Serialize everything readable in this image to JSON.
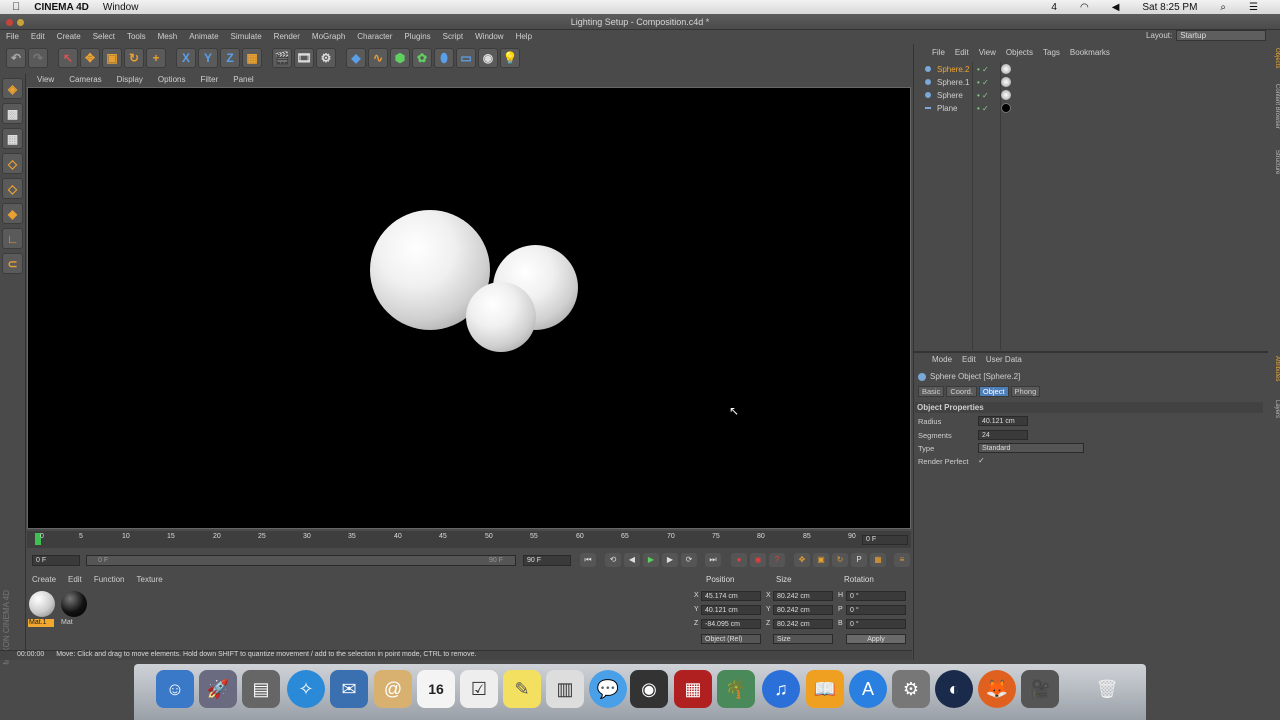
{
  "mac_menubar": {
    "app": "CINEMA 4D",
    "menu": "Window",
    "status_number": "4",
    "clock": "Sat 8:25 PM"
  },
  "window": {
    "title": "Lighting Setup - Composition.c4d *"
  },
  "c4d_menu": [
    "File",
    "Edit",
    "Create",
    "Select",
    "Tools",
    "Mesh",
    "Animate",
    "Simulate",
    "Render",
    "MoGraph",
    "Character",
    "Plugins",
    "Script",
    "Window",
    "Help"
  ],
  "layout": {
    "label": "Layout:",
    "value": "Startup"
  },
  "viewport_menu": [
    "View",
    "Cameras",
    "Display",
    "Options",
    "Filter",
    "Panel"
  ],
  "timeline": {
    "ticks": [
      "0",
      "5",
      "10",
      "15",
      "20",
      "25",
      "30",
      "35",
      "40",
      "45",
      "50",
      "55",
      "60",
      "65",
      "70",
      "75",
      "80",
      "85",
      "90"
    ],
    "frame_field": "0 F",
    "start_field": "0 F",
    "range_left": "0 F",
    "range_right": "90 F",
    "end_field": "90 F"
  },
  "material_manager": {
    "menu": [
      "Create",
      "Edit",
      "Function",
      "Texture"
    ],
    "materials": [
      {
        "name": "Mat.1",
        "selected": true
      },
      {
        "name": "Mat",
        "selected": false
      }
    ],
    "brand": "MAXON CINEMA 4D"
  },
  "coordinates": {
    "headers": [
      "Position",
      "Size",
      "Rotation"
    ],
    "rows": [
      {
        "axis": "X",
        "pos": "45.174 cm",
        "size_axis": "X",
        "size": "80.242 cm",
        "rot_axis": "H",
        "rot": "0 °"
      },
      {
        "axis": "Y",
        "pos": "40.121 cm",
        "size_axis": "Y",
        "size": "80.242 cm",
        "rot_axis": "P",
        "rot": "0 °"
      },
      {
        "axis": "Z",
        "pos": "-84.095 cm",
        "size_axis": "Z",
        "size": "80.242 cm",
        "rot_axis": "B",
        "rot": "0 °"
      }
    ],
    "mode_select": "Object (Rel)",
    "size_select": "Size",
    "apply": "Apply"
  },
  "status_bar": {
    "time": "00:00:00",
    "message": "Move: Click and drag to move elements. Hold down SHIFT to quantize movement / add to the selection in point mode, CTRL to remove."
  },
  "object_manager": {
    "menu": [
      "File",
      "Edit",
      "View",
      "Objects",
      "Tags",
      "Bookmarks"
    ],
    "objects": [
      {
        "name": "Sphere.2",
        "selected": true
      },
      {
        "name": "Sphere.1",
        "selected": false
      },
      {
        "name": "Sphere",
        "selected": false
      },
      {
        "name": "Plane",
        "selected": false
      }
    ]
  },
  "attribute_manager": {
    "menu": [
      "Mode",
      "Edit",
      "User Data"
    ],
    "title": "Sphere Object [Sphere.2]",
    "tabs": [
      {
        "label": "Basic",
        "active": false
      },
      {
        "label": "Coord.",
        "active": false
      },
      {
        "label": "Object",
        "active": true
      },
      {
        "label": "Phong",
        "active": false
      }
    ],
    "section": "Object Properties",
    "properties": [
      {
        "label": "Radius",
        "value": "40.121 cm"
      },
      {
        "label": "Segments",
        "value": "24"
      },
      {
        "label": "Type",
        "value": "Standard"
      },
      {
        "label": "Render Perfect",
        "value": "✓"
      }
    ]
  },
  "side_tabs": [
    "Objects",
    "Content Browser",
    "Structure",
    "Attributes",
    "Layers"
  ],
  "colors": {
    "accent_orange": "#f0a830",
    "selection_blue": "#4f7fb8",
    "viewport_bg": "#000000",
    "ui_gray": "#4a4a4a"
  }
}
